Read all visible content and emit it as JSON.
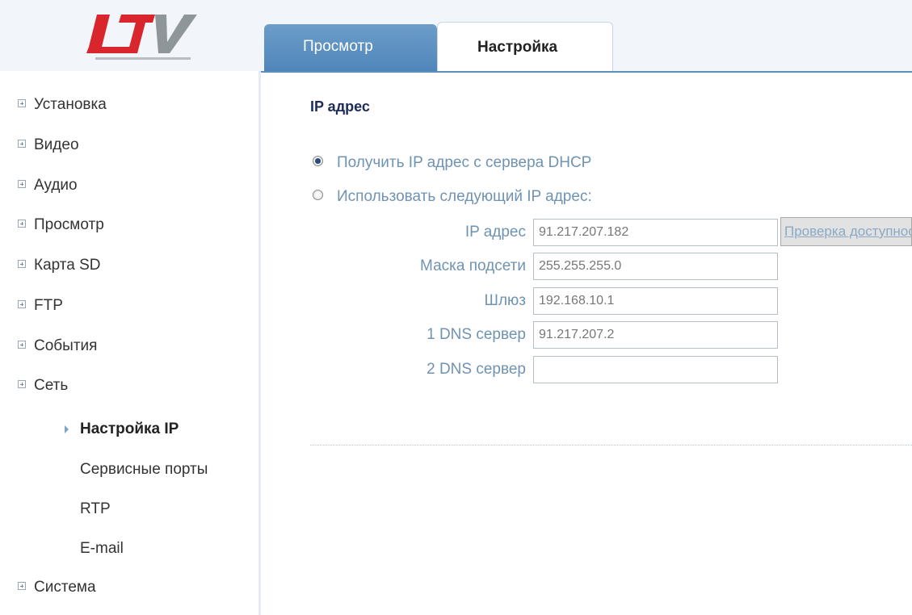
{
  "tabs": [
    {
      "label": "Просмотр",
      "active": false
    },
    {
      "label": "Настройка",
      "active": true
    }
  ],
  "logo": {
    "text": "LTV",
    "colors": {
      "red": "#d8262c",
      "gray": "#8f969b"
    }
  },
  "sidebar": {
    "items": [
      {
        "label": "Установка"
      },
      {
        "label": "Видео"
      },
      {
        "label": "Аудио"
      },
      {
        "label": "Просмотр"
      },
      {
        "label": "Карта SD"
      },
      {
        "label": "FTP"
      },
      {
        "label": "События"
      },
      {
        "label": "Сеть"
      },
      {
        "label": "Система"
      }
    ],
    "sub_items": [
      {
        "label": "Настройка IP",
        "active": true
      },
      {
        "label": "Сервисные порты"
      },
      {
        "label": "RTP"
      },
      {
        "label": "E-mail"
      }
    ]
  },
  "content": {
    "title": "IP адрес",
    "radio_dhcp": {
      "label": "Получить IP адрес с сервера DHCP",
      "checked": true
    },
    "radio_static": {
      "label": "Использовать следующий IP адрес:",
      "checked": false
    },
    "fields": [
      {
        "label": "IP адрес",
        "value": "91.217.207.182"
      },
      {
        "label": "Маска подсети",
        "value": "255.255.255.0"
      },
      {
        "label": "Шлюз",
        "value": "192.168.10.1"
      },
      {
        "label": "1 DNS сервер",
        "value": "91.217.207.2"
      },
      {
        "label": "2 DNS сервер",
        "value": ""
      }
    ],
    "check_button": "Проверка доступности"
  },
  "colors": {
    "tab_blue": "#5b8fc0",
    "label_blue": "#6f93b2",
    "title_navy": "#1e2d58"
  }
}
